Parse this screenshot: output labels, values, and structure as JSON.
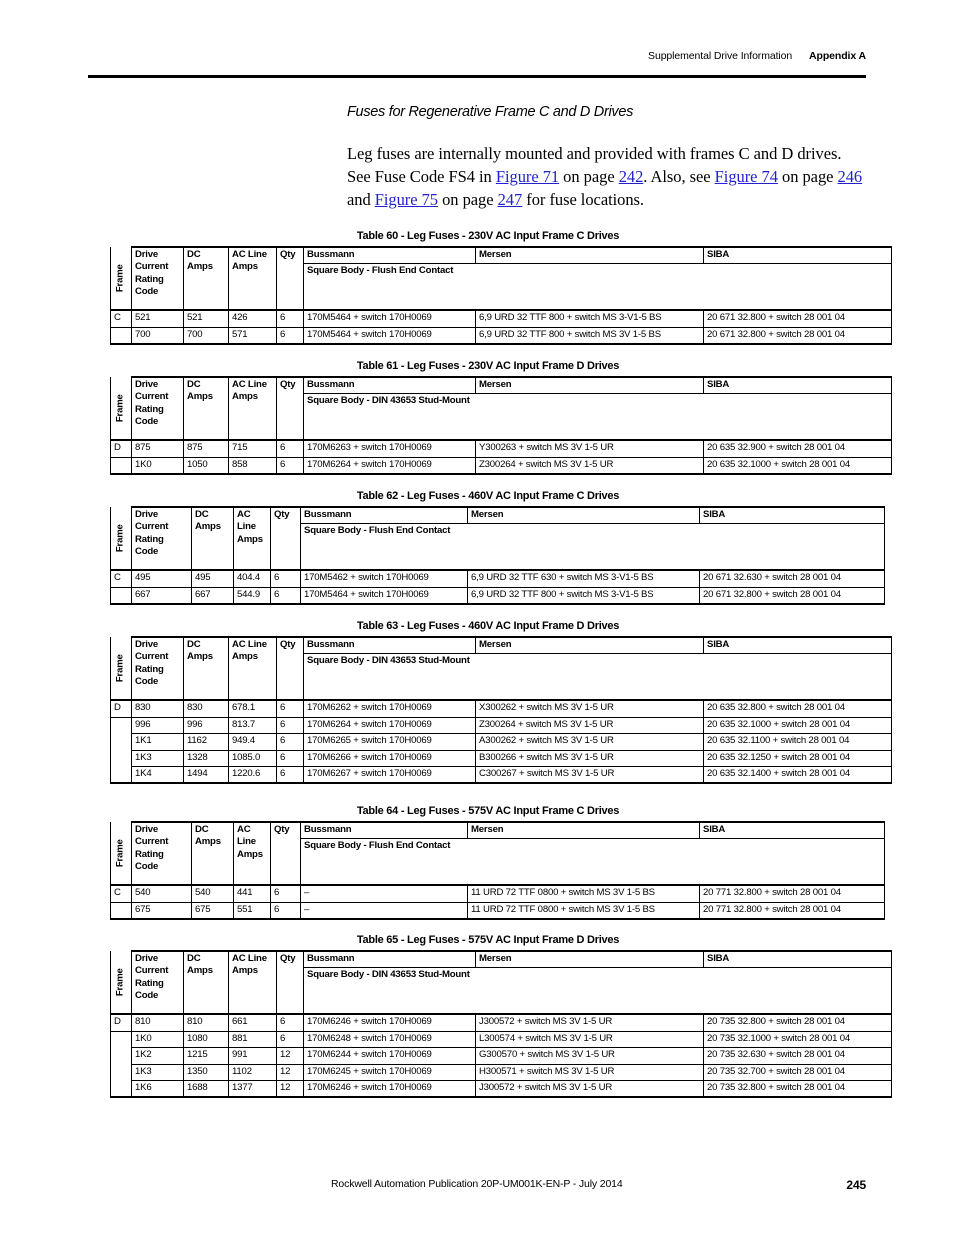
{
  "header": {
    "section": "Supplemental Drive Information",
    "appendix": "Appendix A"
  },
  "section_title": "Fuses for Regenerative Frame C and D Drives",
  "paragraph": {
    "t1": "Leg fuses are internally mounted and provided with frames C and D drives. See Fuse Code FS4 in ",
    "l1": "Figure 71",
    "t2": " on page ",
    "l2": "242",
    "t3": ". Also, see ",
    "l3": "Figure 74",
    "t4": " on page ",
    "l4": "246",
    "t5": " and ",
    "l5": "Figure 75",
    "t6": " on page ",
    "l6": "247",
    "t7": " for fuse locations."
  },
  "common": {
    "frame_label": "Frame",
    "col_drive": "Drive Current Rating Code",
    "col_dc": "DC Amps",
    "col_qty": "Qty",
    "col_bussmann": "Bussmann",
    "col_mersen": "Mersen",
    "col_siba": "SIBA",
    "sub_flush": "Square Body - Flush End Contact",
    "sub_din": "Square Body - DIN 43653 Stud-Mount"
  },
  "tables": [
    {
      "id": "table-60",
      "caption": "Table 60 - Leg Fuses - 230V AC Input Frame C Drives",
      "frame": "C",
      "ac_header": "AC Line Amps",
      "ac_header_lines": [
        "AC Line",
        "Amps"
      ],
      "subheader": "Square Body - Flush End Contact",
      "columns": [
        "Frame",
        "Drive Current Rating Code",
        "DC Amps",
        "AC Line Amps",
        "Qty",
        "Bussmann",
        "Mersen",
        "SIBA"
      ],
      "rows": [
        {
          "drive_code": "521",
          "dc_amps": "521",
          "ac_line_amps": "426",
          "qty": "6",
          "bussmann": "170M5464 + switch 170H0069",
          "mersen": "6,9 URD 32 TTF 800 + switch MS 3-V1-5 BS",
          "siba": "20 671 32.800 + switch 28 001 04"
        },
        {
          "drive_code": "700",
          "dc_amps": "700",
          "ac_line_amps": "571",
          "qty": "6",
          "bussmann": "170M5464 + switch 170H0069",
          "mersen": "6,9 URD 32 TTF 800 + switch MS 3V 1-5 BS",
          "siba": "20 671 32.800 + switch 28 001 04"
        }
      ]
    },
    {
      "id": "table-61",
      "caption": "Table 61 - Leg Fuses - 230V AC Input Frame D Drives",
      "frame": "D",
      "ac_header": "AC Line Amps",
      "ac_header_lines": [
        "AC Line",
        "Amps"
      ],
      "subheader": "Square Body - DIN 43653 Stud-Mount",
      "columns": [
        "Frame",
        "Drive Current Rating Code",
        "DC Amps",
        "AC Line Amps",
        "Qty",
        "Bussmann",
        "Mersen",
        "SIBA"
      ],
      "rows": [
        {
          "drive_code": "875",
          "dc_amps": "875",
          "ac_line_amps": "715",
          "qty": "6",
          "bussmann": "170M6263 + switch 170H0069",
          "mersen": "Y300263 + switch MS 3V 1-5 UR",
          "siba": "20 635 32.900 + switch 28 001 04"
        },
        {
          "drive_code": "1K0",
          "dc_amps": "1050",
          "ac_line_amps": "858",
          "qty": "6",
          "bussmann": "170M6264 + switch 170H0069",
          "mersen": "Z300264 + switch MS 3V 1-5 UR",
          "siba": "20 635 32.1000 + switch 28 001 04"
        }
      ]
    },
    {
      "id": "table-62",
      "caption": "Table 62 - Leg Fuses - 460V AC Input Frame C Drives",
      "frame": "C",
      "ac_header": "AC Line Amps",
      "ac_header_lines": [
        "AC",
        "Line",
        "Amps"
      ],
      "subheader": "Square Body - Flush End Contact",
      "columns": [
        "Frame",
        "Drive Current Rating Code",
        "DC Amps",
        "AC Line Amps",
        "Qty",
        "Bussmann",
        "Mersen",
        "SIBA"
      ],
      "rows": [
        {
          "drive_code": "495",
          "dc_amps": "495",
          "ac_line_amps": "404.4",
          "qty": "6",
          "bussmann": "170M5462 + switch 170H0069",
          "mersen": "6,9 URD 32 TTF 630 + switch MS 3-V1-5 BS",
          "siba": "20 671 32.630 + switch 28 001 04"
        },
        {
          "drive_code": "667",
          "dc_amps": "667",
          "ac_line_amps": "544.9",
          "qty": "6",
          "bussmann": "170M5464 + switch 170H0069",
          "mersen": "6,9 URD 32 TTF 800 + switch MS 3-V1-5 BS",
          "siba": "20 671 32.800 + switch 28 001 04"
        }
      ]
    },
    {
      "id": "table-63",
      "caption": "Table 63 - Leg Fuses - 460V AC Input Frame D Drives",
      "frame": "D",
      "ac_header": "AC Line Amps",
      "ac_header_lines": [
        "AC Line",
        "Amps"
      ],
      "subheader": "Square Body - DIN 43653 Stud-Mount",
      "columns": [
        "Frame",
        "Drive Current Rating Code",
        "DC Amps",
        "AC Line Amps",
        "Qty",
        "Bussmann",
        "Mersen",
        "SIBA"
      ],
      "rows": [
        {
          "drive_code": "830",
          "dc_amps": "830",
          "ac_line_amps": "678.1",
          "qty": "6",
          "bussmann": "170M6262 + switch 170H0069",
          "mersen": "X300262 + switch MS 3V 1-5 UR",
          "siba": "20 635 32.800 + switch 28 001 04"
        },
        {
          "drive_code": "996",
          "dc_amps": "996",
          "ac_line_amps": "813.7",
          "qty": "6",
          "bussmann": "170M6264 + switch 170H0069",
          "mersen": "Z300264 + switch MS 3V 1-5 UR",
          "siba": "20 635 32.1000 + switch 28 001 04"
        },
        {
          "drive_code": "1K1",
          "dc_amps": "1162",
          "ac_line_amps": "949.4",
          "qty": "6",
          "bussmann": "170M6265 + switch 170H0069",
          "mersen": "A300262 + switch MS 3V 1-5 UR",
          "siba": "20 635 32.1100 + switch 28 001 04"
        },
        {
          "drive_code": "1K3",
          "dc_amps": "1328",
          "ac_line_amps": "1085.0",
          "qty": "6",
          "bussmann": "170M6266 + switch 170H0069",
          "mersen": "B300266 + switch MS 3V 1-5 UR",
          "siba": "20 635 32.1250 + switch 28 001 04"
        },
        {
          "drive_code": "1K4",
          "dc_amps": "1494",
          "ac_line_amps": "1220.6",
          "qty": "6",
          "bussmann": "170M6267 + switch 170H0069",
          "mersen": "C300267 + switch MS 3V 1-5 UR",
          "siba": "20 635 32.1400 + switch 28 001 04"
        }
      ]
    },
    {
      "id": "table-64",
      "caption": "Table 64 - Leg Fuses - 575V AC Input Frame C Drives",
      "frame": "C",
      "ac_header": "AC Line Amps",
      "ac_header_lines": [
        "AC",
        "Line",
        "Amps"
      ],
      "subheader": "Square Body - Flush End Contact",
      "columns": [
        "Frame",
        "Drive Current Rating Code",
        "DC Amps",
        "AC Line Amps",
        "Qty",
        "Bussmann",
        "Mersen",
        "SIBA"
      ],
      "rows": [
        {
          "drive_code": "540",
          "dc_amps": "540",
          "ac_line_amps": "441",
          "qty": "6",
          "bussmann": "–",
          "mersen": "11 URD 72 TTF 0800 + switch MS 3V 1-5 BS",
          "siba": "20 771 32.800 + switch 28 001 04"
        },
        {
          "drive_code": "675",
          "dc_amps": "675",
          "ac_line_amps": "551",
          "qty": "6",
          "bussmann": "–",
          "mersen": "11 URD 72 TTF 0800 + switch MS 3V 1-5 BS",
          "siba": "20 771 32.800 + switch 28 001 04"
        }
      ]
    },
    {
      "id": "table-65",
      "caption": "Table 65 - Leg Fuses - 575V AC Input Frame D Drives",
      "frame": "D",
      "ac_header": "AC Line Amps",
      "ac_header_lines": [
        "AC Line",
        "Amps"
      ],
      "subheader": "Square Body - DIN 43653 Stud-Mount",
      "columns": [
        "Frame",
        "Drive Current Rating Code",
        "DC Amps",
        "AC Line Amps",
        "Qty",
        "Bussmann",
        "Mersen",
        "SIBA"
      ],
      "rows": [
        {
          "drive_code": "810",
          "dc_amps": "810",
          "ac_line_amps": "661",
          "qty": "6",
          "bussmann": "170M6246 + switch 170H0069",
          "mersen": "J300572 + switch MS 3V 1-5 UR",
          "siba": "20 735 32.800 + switch 28 001 04"
        },
        {
          "drive_code": "1K0",
          "dc_amps": "1080",
          "ac_line_amps": "881",
          "qty": "6",
          "bussmann": "170M6248 + switch 170H0069",
          "mersen": "L300574 + switch MS 3V 1-5 UR",
          "siba": "20 735 32.1000 + switch 28 001 04"
        },
        {
          "drive_code": "1K2",
          "dc_amps": "1215",
          "ac_line_amps": "991",
          "qty": "12",
          "bussmann": "170M6244 + switch 170H0069",
          "mersen": "G300570 + switch MS 3V 1-5 UR",
          "siba": "20 735 32.630 + switch 28 001 04"
        },
        {
          "drive_code": "1K3",
          "dc_amps": "1350",
          "ac_line_amps": "1102",
          "qty": "12",
          "bussmann": "170M6245 + switch 170H0069",
          "mersen": "H300571 + switch MS 3V 1-5 UR",
          "siba": "20 735 32.700 + switch 28 001 04"
        },
        {
          "drive_code": "1K6",
          "dc_amps": "1688",
          "ac_line_amps": "1377",
          "qty": "12",
          "bussmann": "170M6246 + switch 170H0069",
          "mersen": "J300572 + switch MS 3V 1-5 UR",
          "siba": "20 735 32.800 + switch 28 001 04"
        }
      ]
    }
  ],
  "footer": {
    "publication": "Rockwell Automation Publication 20P-UM001K-EN-P - July 2014",
    "page_number": "245"
  }
}
